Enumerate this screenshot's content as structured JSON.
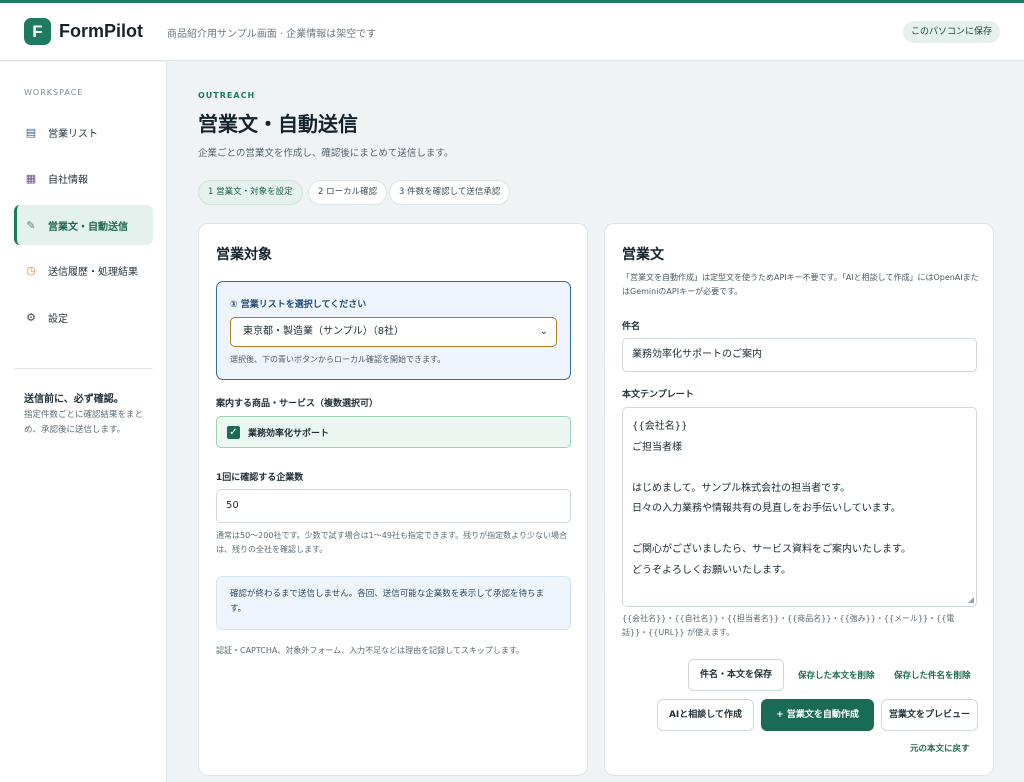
{
  "header": {
    "logo_letter": "F",
    "brand": "FormPilot",
    "tagline": "商品紹介用サンプル画面 · 企業情報は架空です",
    "save_button": "このパソコンに保存"
  },
  "sidebar": {
    "workspace_label": "WORKSPACE",
    "items": [
      {
        "label": "営業リスト",
        "icon": "list-icon"
      },
      {
        "label": "自社情報",
        "icon": "grid-icon"
      },
      {
        "label": "営業文・自動送信",
        "icon": "pen-icon",
        "active": true
      },
      {
        "label": "送信履歴・処理結果",
        "icon": "clock-icon"
      },
      {
        "label": "設定",
        "icon": "gear-icon"
      }
    ],
    "note_title": "送信前に、必ず確認。",
    "note_text": "指定件数ごとに確認結果をまとめ、承認後に送信します。"
  },
  "page": {
    "eyebrow": "OUTREACH",
    "title": "営業文・自動送信",
    "subtitle": "企業ごとの営業文を作成し、確認後にまとめて送信します。",
    "steps": [
      "1 営業文・対象を設定",
      "2 ローカル確認",
      "3 件数を確認して送信承認"
    ],
    "active_step": 0
  },
  "target_card": {
    "title": "営業対象",
    "select_label": "① 営業リストを選択してください",
    "select_value": "東京都・製造業（サンプル）（8社）",
    "select_hint": "選択後、下の青いボタンからローカル確認を開始できます。",
    "products_label": "案内する商品・サービス（複数選択可）",
    "product_option": "業務効率化サポート",
    "product_checked": true,
    "count_label": "1回に確認する企業数",
    "count_value": "50",
    "count_help": "通常は50〜200社です。少数で試す場合は1〜49社も指定できます。残りが指定数より少ない場合は、残りの全社を確認します。",
    "info_text": "確認が終わるまで送信しません。各回、送信可能な企業数を表示して承認を待ちます。",
    "skip_note": "認証・CAPTCHA、対象外フォーム、入力不足などは理由を記録してスキップします。"
  },
  "message_card": {
    "title": "営業文",
    "description": "「営業文を自動作成」は定型文を使うためAPIキー不要です。「AIと相談して作成」にはOpenAIまたはGeminiのAPIキーが必要です。",
    "subject_label": "件名",
    "subject_value": "業務効率化サポートのご案内",
    "body_label": "本文テンプレート",
    "body_lines": [
      "{{会社名}}",
      "ご担当者様",
      "",
      "はじめまして。サンプル株式会社の担当者です。",
      "日々の入力業務や情報共有の見直しをお手伝いしています。",
      "",
      "ご関心がございましたら、サービス資料をご案内いたします。",
      "どうぞよろしくお願いいたします。"
    ],
    "placeholders_help": "{{会社名}}・{{自社名}}・{{担当者名}}・{{商品名}}・{{強み}}・{{メール}}・{{電話}}・{{URL}} が使えます。",
    "save_button": "件名・本文を保存",
    "delete_body_link": "保存した本文を削除",
    "delete_subject_link": "保存した件名を削除",
    "ai_button": "AIと相談して作成",
    "auto_button": "+ 営業文を自動作成",
    "preview_button": "営業文をプレビュー",
    "restore_link": "元の本文に戻す"
  },
  "colors": {
    "accent": "#1f7a62",
    "select_border": "#2d6ea4",
    "info_bg": "#edf4fc"
  }
}
